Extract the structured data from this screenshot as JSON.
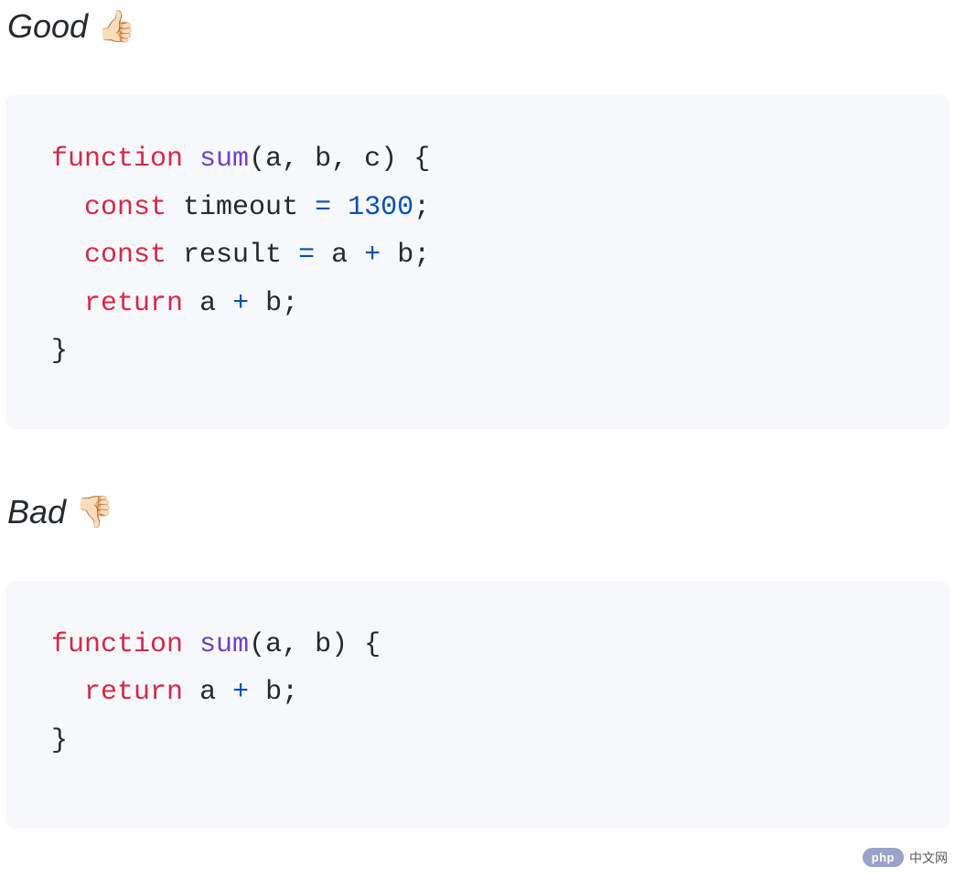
{
  "sections": {
    "good": {
      "label": "Good",
      "emoji": "👍🏻",
      "code": {
        "tokens": [
          {
            "t": "kw-decl",
            "v": "function"
          },
          {
            "t": "sp",
            "v": " "
          },
          {
            "t": "fn-name",
            "v": "sum"
          },
          {
            "t": "punct",
            "v": "("
          },
          {
            "t": "param",
            "v": "a"
          },
          {
            "t": "punct",
            "v": ", "
          },
          {
            "t": "param",
            "v": "b"
          },
          {
            "t": "punct",
            "v": ", "
          },
          {
            "t": "param",
            "v": "c"
          },
          {
            "t": "punct",
            "v": ")"
          },
          {
            "t": "sp",
            "v": " "
          },
          {
            "t": "punct",
            "v": "{"
          },
          {
            "t": "nl",
            "v": "\n"
          },
          {
            "t": "sp",
            "v": "  "
          },
          {
            "t": "kw-decl",
            "v": "const"
          },
          {
            "t": "sp",
            "v": " "
          },
          {
            "t": "var",
            "v": "timeout"
          },
          {
            "t": "sp",
            "v": " "
          },
          {
            "t": "op",
            "v": "="
          },
          {
            "t": "sp",
            "v": " "
          },
          {
            "t": "num",
            "v": "1300"
          },
          {
            "t": "punct",
            "v": ";"
          },
          {
            "t": "nl",
            "v": "\n"
          },
          {
            "t": "sp",
            "v": "  "
          },
          {
            "t": "kw-decl",
            "v": "const"
          },
          {
            "t": "sp",
            "v": " "
          },
          {
            "t": "var",
            "v": "result"
          },
          {
            "t": "sp",
            "v": " "
          },
          {
            "t": "op",
            "v": "="
          },
          {
            "t": "sp",
            "v": " "
          },
          {
            "t": "var",
            "v": "a"
          },
          {
            "t": "sp",
            "v": " "
          },
          {
            "t": "op",
            "v": "+"
          },
          {
            "t": "sp",
            "v": " "
          },
          {
            "t": "var",
            "v": "b"
          },
          {
            "t": "punct",
            "v": ";"
          },
          {
            "t": "nl",
            "v": "\n"
          },
          {
            "t": "sp",
            "v": "  "
          },
          {
            "t": "kw-decl",
            "v": "return"
          },
          {
            "t": "sp",
            "v": " "
          },
          {
            "t": "var",
            "v": "a"
          },
          {
            "t": "sp",
            "v": " "
          },
          {
            "t": "op",
            "v": "+"
          },
          {
            "t": "sp",
            "v": " "
          },
          {
            "t": "var",
            "v": "b"
          },
          {
            "t": "punct",
            "v": ";"
          },
          {
            "t": "nl",
            "v": "\n"
          },
          {
            "t": "punct",
            "v": "}"
          }
        ]
      }
    },
    "bad": {
      "label": "Bad",
      "emoji": "👎🏻",
      "code": {
        "tokens": [
          {
            "t": "kw-decl",
            "v": "function"
          },
          {
            "t": "sp",
            "v": " "
          },
          {
            "t": "fn-name",
            "v": "sum"
          },
          {
            "t": "punct",
            "v": "("
          },
          {
            "t": "param",
            "v": "a"
          },
          {
            "t": "punct",
            "v": ", "
          },
          {
            "t": "param",
            "v": "b"
          },
          {
            "t": "punct",
            "v": ")"
          },
          {
            "t": "sp",
            "v": " "
          },
          {
            "t": "punct",
            "v": "{"
          },
          {
            "t": "nl",
            "v": "\n"
          },
          {
            "t": "sp",
            "v": "  "
          },
          {
            "t": "kw-decl",
            "v": "return"
          },
          {
            "t": "sp",
            "v": " "
          },
          {
            "t": "var",
            "v": "a"
          },
          {
            "t": "sp",
            "v": " "
          },
          {
            "t": "op",
            "v": "+"
          },
          {
            "t": "sp",
            "v": " "
          },
          {
            "t": "var",
            "v": "b"
          },
          {
            "t": "punct",
            "v": ";"
          },
          {
            "t": "nl",
            "v": "\n"
          },
          {
            "t": "punct",
            "v": "}"
          }
        ]
      }
    }
  },
  "watermark": {
    "badge": "php",
    "text": "中文网"
  }
}
